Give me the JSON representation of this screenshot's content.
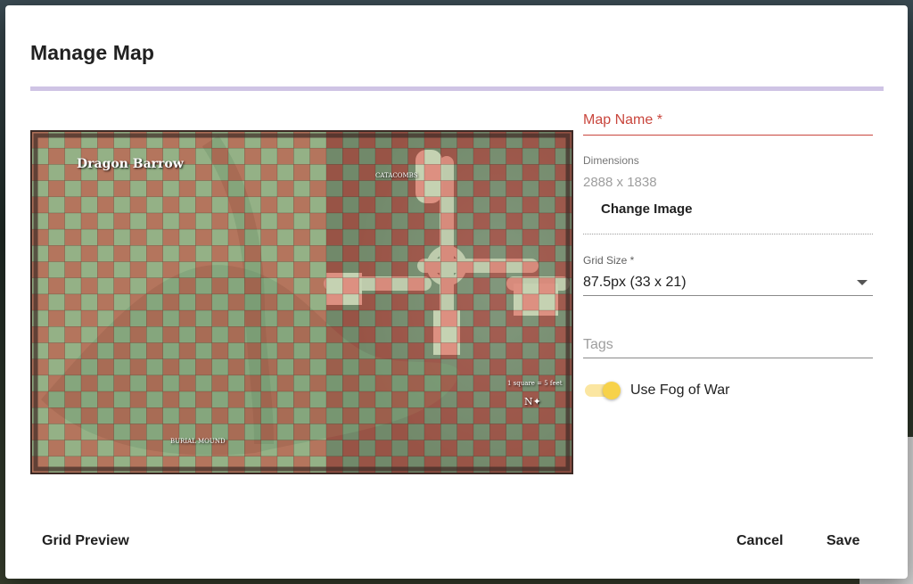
{
  "dialog": {
    "title": "Manage Map"
  },
  "map": {
    "title": "Dragon Barrow",
    "labels": {
      "catacombs": "CATACOMBS",
      "burial_mound": "BURIAL MOUND",
      "scale": "1 square = 5 feet",
      "compass": "N"
    }
  },
  "form": {
    "map_name_label": "Map Name *",
    "map_name_value": "",
    "dimensions_label": "Dimensions",
    "dimensions_value": "2888 x 1838",
    "change_image_label": "Change Image",
    "grid_size_label": "Grid Size *",
    "grid_size_value": "87.5px (33 x 21)",
    "tags_placeholder": "Tags",
    "fog_label": "Use Fog of War",
    "fog_enabled": true
  },
  "footer": {
    "grid_preview_label": "Grid Preview",
    "cancel_label": "Cancel",
    "save_label": "Save"
  },
  "colors": {
    "accent_error": "#c9463d",
    "progress": "#cfc4e5",
    "switch_thumb": "#f7d24a",
    "switch_track": "#fbe6a1",
    "grid_red": "#d5584a",
    "grid_green": "#9ecf9e"
  }
}
